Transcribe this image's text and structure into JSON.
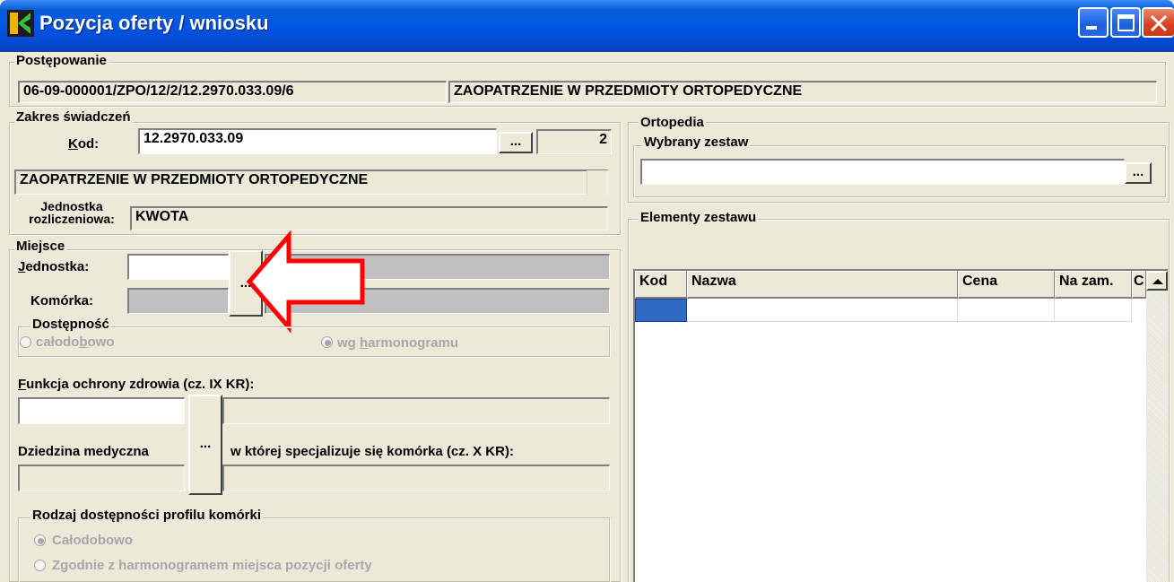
{
  "window": {
    "title": "Pozycja oferty / wniosku"
  },
  "postepowanie": {
    "label": "Postępowanie",
    "code": "06-09-000001/ZPO/12/2/12.2970.033.09/6",
    "name": "ZAOPATRZENIE W PRZEDMIOTY ORTOPEDYCZNE"
  },
  "zakres": {
    "label": "Zakres świadczeń",
    "kod_label_u": "K",
    "kod_label_rest": "od:",
    "kod_value": "12.2970.033.09",
    "kod_button": "...",
    "count": "2",
    "description": "ZAOPATRZENIE W PRZEDMIOTY  ORTOPEDYCZNE",
    "jednostka_label_1": "Jednostka",
    "jednostka_label_2": "rozliczeniowa:",
    "jednostka_value": "KWOTA"
  },
  "miejsce": {
    "label": "Miejsce",
    "jednostka_label_u": "J",
    "jednostka_label_rest": "ednostka:",
    "komorka_label": "Komórka:",
    "button": "...",
    "dostepnosc_label": "Dostępność",
    "radio1_pre": "całodo",
    "radio1_u": "b",
    "radio1_post": "owo",
    "radio2_pre": "wg ",
    "radio2_u": "h",
    "radio2_post": "armonogramu"
  },
  "funkcja": {
    "label_u": "F",
    "label_rest": "unkcja ochrony zdrowia (cz. IX KR):",
    "dziedzina_label": "Dziedzina medyczna",
    "dziedzina_rest": "w której specjalizuje się komórka (cz. X KR):",
    "button": "..."
  },
  "rodzaj": {
    "label": "Rodzaj dostępności profilu komórki",
    "opt1": "Całodobowo",
    "opt2": "Zgodnie z harmonogramem miejsca pozycji oferty"
  },
  "ortopedia": {
    "label": "Ortopedia",
    "wybrany_label": "Wybrany zestaw",
    "button": "...",
    "elementy_label": "Elementy zestawu",
    "columns": [
      "Kod",
      "Nazwa",
      "Cena",
      "Na zam.",
      "C"
    ]
  },
  "colors": {
    "arrow": "#FF0000",
    "title_blue": "#0054E3",
    "selected_cell": "#316AC5"
  }
}
